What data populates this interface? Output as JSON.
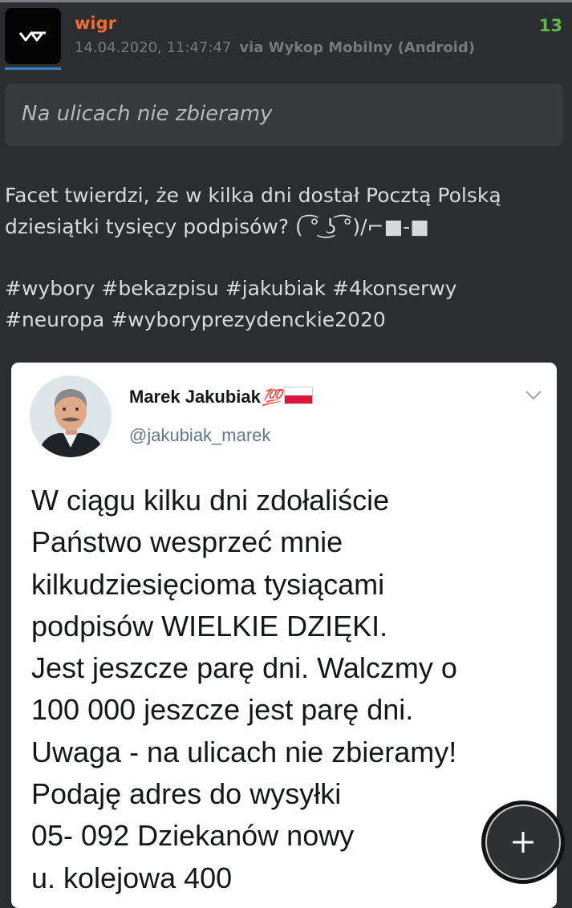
{
  "post": {
    "author": "wigr",
    "date": "14.04.2020, 11:47:47",
    "via": "via Wykop Mobilny (Android)",
    "votes": "13",
    "quote": "Na ulicach nie zbieramy",
    "body_lines": [
      "Facet twierdzi, że w kilka dni dostał Pocztą Polską",
      "dziesiątki tysięcy podpisów? ( ͡° ͜ʖ ͡°)/⌐■-■"
    ],
    "tags": [
      "#wybory",
      "#bekazpisu",
      "#jakubiak",
      "#4konserwy",
      "#neuropa",
      "#wyboryprezydenckie2020"
    ],
    "avatar_icon": "wykop-logo-icon"
  },
  "embed": {
    "name": "Marek Jakubiak",
    "name_emoji": "💯",
    "handle": "@jakubiak_marek",
    "text_lines": [
      "W ciągu kilku dni zdołaliście",
      "Państwo wesprzeć mnie",
      "kilkudziesięcioma tysiącami",
      "podpisów WIELKIE DZIĘKI.",
      "Jest jeszcze parę dni. Walczmy o",
      "100 000 jeszcze jest parę dni.",
      "Uwaga - na ulicach nie zbieramy!",
      "Podaję adres do wysyłki",
      "05- 092 Dziekanów nowy",
      "u. kolejowa 400"
    ]
  },
  "fab": {
    "icon": "plus-icon"
  },
  "colors": {
    "background": "#2c2d31",
    "author": "#ef6d2f",
    "votes": "#5fb84a",
    "accent": "#3b82c4"
  }
}
